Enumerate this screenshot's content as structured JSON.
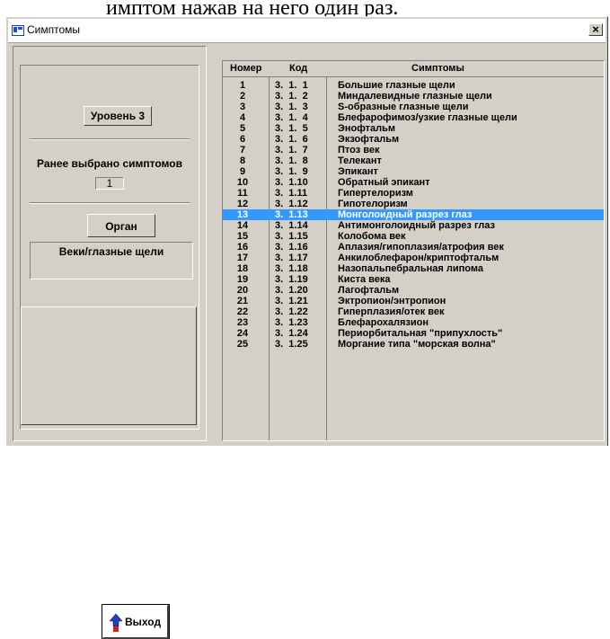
{
  "background_text": "имптом нажав на него один раз.",
  "window": {
    "title": "Симптомы",
    "close_label": "×"
  },
  "left": {
    "level_label": "Уровень 3",
    "previously_selected_label": "Ранее выбрано симптомов",
    "previously_selected_value": "1",
    "organ_label": "Орган",
    "organ_value": "Веки/глазные щели",
    "exit_label": "Выход"
  },
  "list": {
    "headers": {
      "number": "Номер",
      "code": "Код",
      "symptoms": "Симптомы"
    },
    "selected_index": 12,
    "rows": [
      {
        "num": "1",
        "code": "3.  1.  1",
        "sym": "Большие глазные щели"
      },
      {
        "num": "2",
        "code": "3.  1.  2",
        "sym": "Миндалевидные глазные щели"
      },
      {
        "num": "3",
        "code": "3.  1.  3",
        "sym": "S-образные глазные щели"
      },
      {
        "num": "4",
        "code": "3.  1.  4",
        "sym": "Блефарофимоз/узкие глазные щели"
      },
      {
        "num": "5",
        "code": "3.  1.  5",
        "sym": "Энофтальм"
      },
      {
        "num": "6",
        "code": "3.  1.  6",
        "sym": "Экзофтальм"
      },
      {
        "num": "7",
        "code": "3.  1.  7",
        "sym": "Птоз век"
      },
      {
        "num": "8",
        "code": "3.  1.  8",
        "sym": "Телекант"
      },
      {
        "num": "9",
        "code": "3.  1.  9",
        "sym": "Эпикант"
      },
      {
        "num": "10",
        "code": "3.  1.10",
        "sym": "Обратный эпикант"
      },
      {
        "num": "11",
        "code": "3.  1.11",
        "sym": "Гипертелоризм"
      },
      {
        "num": "12",
        "code": "3.  1.12",
        "sym": "Гипотелоризм"
      },
      {
        "num": "13",
        "code": "3.  1.13",
        "sym": "Монголоидный разрез глаз"
      },
      {
        "num": "14",
        "code": "3.  1.14",
        "sym": "Антимонголоидный разрез глаз"
      },
      {
        "num": "15",
        "code": "3.  1.15",
        "sym": "Колобома век"
      },
      {
        "num": "16",
        "code": "3.  1.16",
        "sym": "Аплазия/гипоплазия/атрофия век"
      },
      {
        "num": "17",
        "code": "3.  1.17",
        "sym": "Анкилоблефарон/криптофтальм"
      },
      {
        "num": "18",
        "code": "3.  1.18",
        "sym": "Назопальпебральная липома"
      },
      {
        "num": "19",
        "code": "3.  1.19",
        "sym": "Киста века"
      },
      {
        "num": "20",
        "code": "3.  1.20",
        "sym": "Лагофтальм"
      },
      {
        "num": "21",
        "code": "3.  1.21",
        "sym": "Эктропион/энтропион"
      },
      {
        "num": "22",
        "code": "3.  1.22",
        "sym": "Гиперплазия/отек век"
      },
      {
        "num": "23",
        "code": "3.  1.23",
        "sym": "Блефарохалязион"
      },
      {
        "num": "24",
        "code": "3.  1.24",
        "sym": "Периорбитальная \"припухлость\""
      },
      {
        "num": "25",
        "code": "3.  1.25",
        "sym": "Моргание типа \"морская волна\""
      }
    ]
  }
}
